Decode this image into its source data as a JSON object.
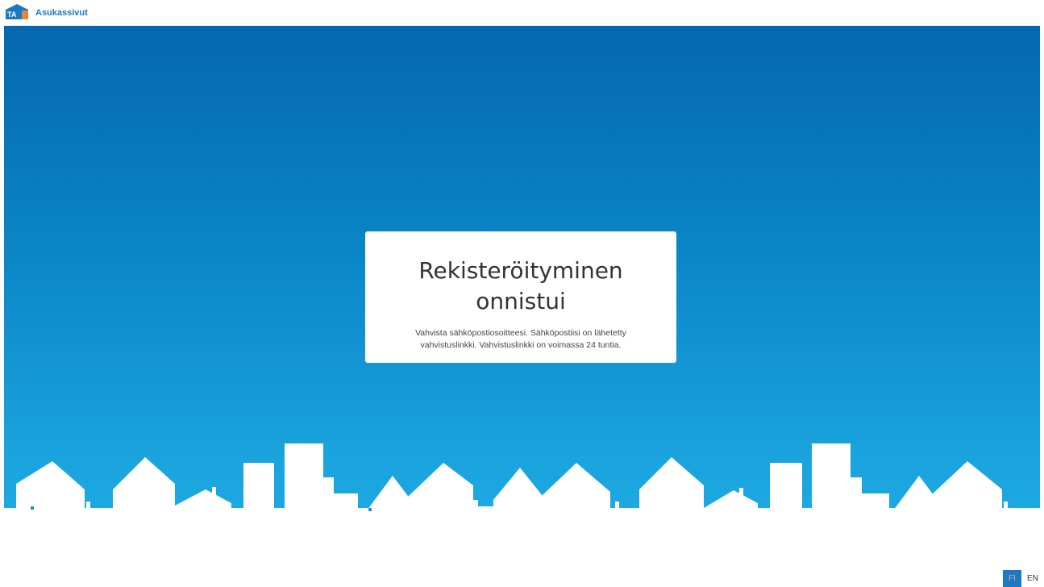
{
  "header": {
    "logo_text": "TA",
    "brand_name": "Asukassivut"
  },
  "main": {
    "title": "Rekisteröityminen onnistui",
    "message": "Vahvista sähköpostiosoitteesi. Sähköpostiisi on lähetetty vahvistuslinkki. Vahvistuslinkki on voimassa 24 tuntia."
  },
  "language": {
    "options": [
      "FI",
      "EN"
    ],
    "active": "FI"
  },
  "colors": {
    "brand": "#1b79c1",
    "hero_top": "#0568ae",
    "hero_bottom": "#1eaae3",
    "card": "#ffffff"
  }
}
